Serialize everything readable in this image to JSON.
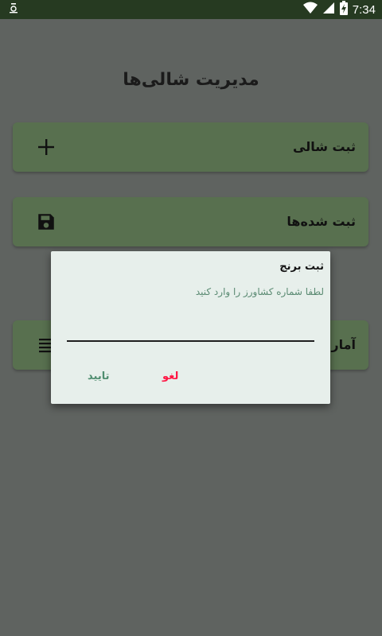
{
  "status_bar": {
    "time": "7:34",
    "notification_icon": "notification-dot-icon",
    "icons": [
      "wifi-icon",
      "signal-icon",
      "battery-charging-icon"
    ]
  },
  "page": {
    "title": "مدیریت شالی‌ها"
  },
  "menu": {
    "items": [
      {
        "label": "ثبت شالی",
        "icon": "plus-icon"
      },
      {
        "label": "ثبت شده‌ها",
        "icon": "save-icon"
      },
      {
        "label": "آمار",
        "icon": "list-icon"
      }
    ]
  },
  "dialog": {
    "title": "ثبت برنج",
    "message": "لطفا شماره کشاورز را وارد کنید",
    "input_value": "",
    "confirm_label": "تایید",
    "cancel_label": "لغو"
  },
  "colors": {
    "status_bar": "#263a21",
    "card": "#58704f",
    "dialog_bg": "#e7efeb",
    "confirm": "#4f8d6f",
    "cancel": "#ff1744"
  }
}
